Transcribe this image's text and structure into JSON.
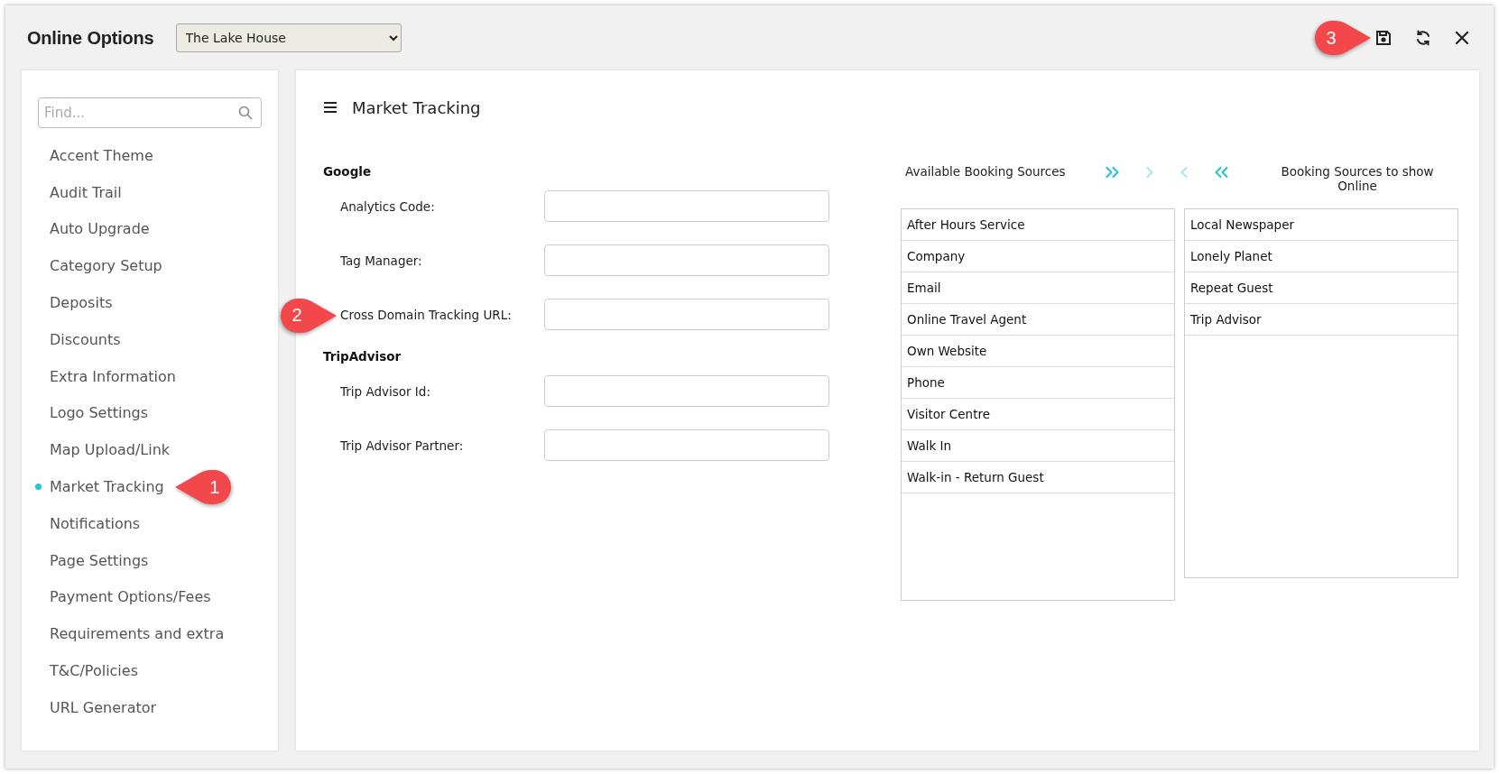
{
  "window": {
    "title": "Online Options",
    "property_select": "The Lake House",
    "toolbar": [
      {
        "kind": "save",
        "callout": "3"
      },
      {
        "kind": "refresh"
      },
      {
        "kind": "close"
      }
    ]
  },
  "sidebar": {
    "search": {
      "placeholder": "Find..."
    },
    "items": [
      {
        "label": "Accent Theme",
        "selected": false
      },
      {
        "label": "Audit Trail",
        "selected": false
      },
      {
        "label": "Auto Upgrade",
        "selected": false
      },
      {
        "label": "Category Setup",
        "selected": false
      },
      {
        "label": "Deposits",
        "selected": false
      },
      {
        "label": "Discounts",
        "selected": false
      },
      {
        "label": "Extra Information",
        "selected": false
      },
      {
        "label": "Logo Settings",
        "selected": false
      },
      {
        "label": "Map Upload/Link",
        "selected": false
      },
      {
        "label": "Market Tracking",
        "selected": true,
        "callout": "1"
      },
      {
        "label": "Notifications",
        "selected": false
      },
      {
        "label": "Page Settings",
        "selected": false
      },
      {
        "label": "Payment Options/Fees",
        "selected": false
      },
      {
        "label": "Requirements and extra",
        "selected": false
      },
      {
        "label": "T&C/Policies",
        "selected": false
      },
      {
        "label": "URL Generator",
        "selected": false
      }
    ]
  },
  "main": {
    "title": "Market Tracking",
    "sections": [
      {
        "heading": "Google",
        "fields": [
          {
            "label": "Analytics Code:"
          },
          {
            "label": "Tag Manager:"
          },
          {
            "label": "Cross Domain Tracking URL:",
            "callout": "2"
          }
        ]
      },
      {
        "heading": "TripAdvisor",
        "fields": [
          {
            "label": "Trip Advisor Id:"
          },
          {
            "label": "Trip Advisor Partner:"
          }
        ]
      }
    ],
    "available": {
      "heading": "Available Booking Sources",
      "items": [
        "After Hours Service",
        "Company",
        "Email",
        "Online Travel Agent",
        "Own Website",
        "Phone",
        "Visitor Centre",
        "Walk In",
        "Walk-in - Return Guest"
      ]
    },
    "transfer_buttons": [
      {
        "kind": "all-right",
        "disabled": false
      },
      {
        "kind": "right",
        "disabled": true
      },
      {
        "kind": "left",
        "disabled": true
      },
      {
        "kind": "all-left",
        "disabled": false
      }
    ],
    "shown": {
      "heading": "Booking Sources to show Online",
      "items": [
        "Local Newspaper",
        "Lonely Planet",
        "Repeat Guest",
        "Trip Advisor"
      ]
    }
  }
}
